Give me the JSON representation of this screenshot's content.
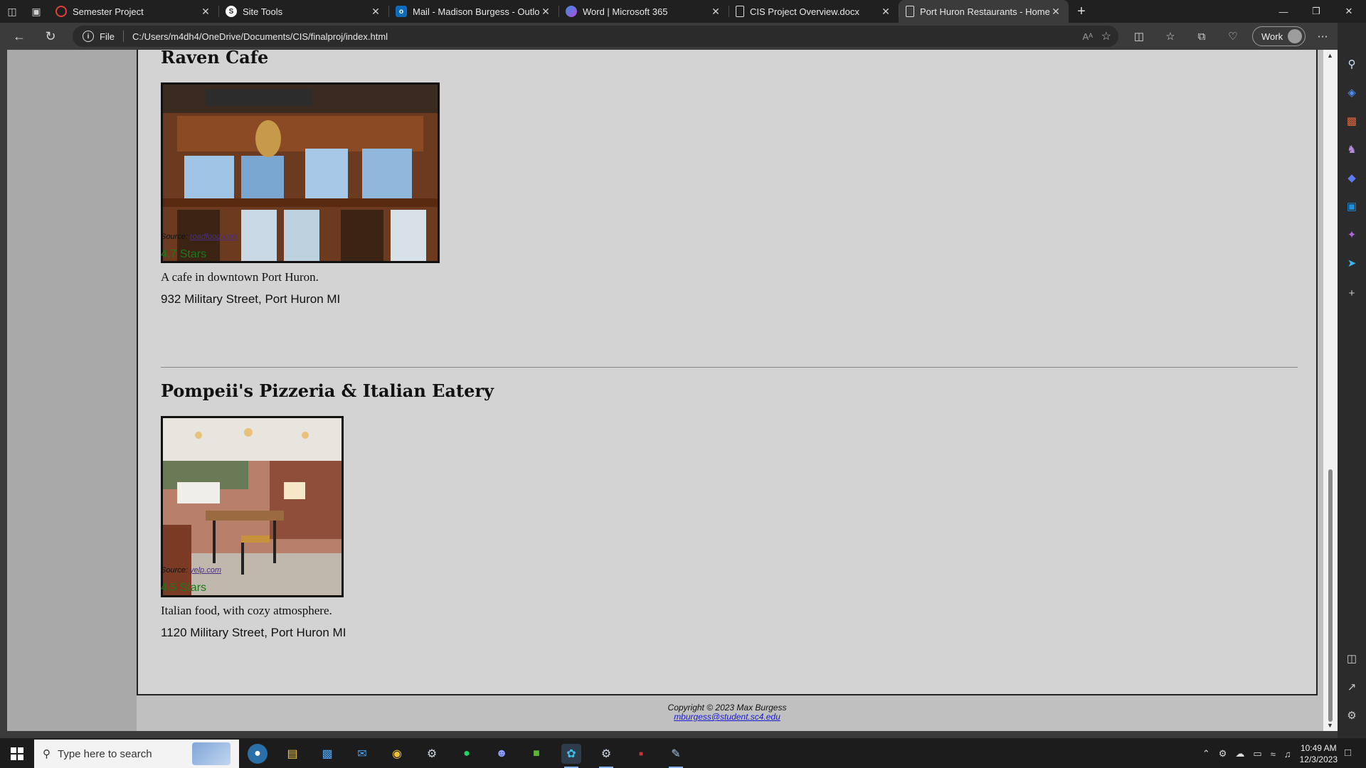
{
  "tabs": [
    {
      "title": "Semester Project",
      "icon": "circle-arrow-icon",
      "color": "#e0413a"
    },
    {
      "title": "Site Tools",
      "icon": "s-logo-icon",
      "color": "#ffffff"
    },
    {
      "title": "Mail - Madison Burgess - Outlook",
      "icon": "outlook-icon",
      "color": "#0f6cbd"
    },
    {
      "title": "Word | Microsoft 365",
      "icon": "m365-icon",
      "color": "#7b61d1"
    },
    {
      "title": "CIS Project Overview.docx",
      "icon": "document-icon",
      "color": "#e8e8e8"
    },
    {
      "title": "Port Huron Restaurants - Home Page",
      "icon": "document-icon",
      "color": "#e8e8e8"
    }
  ],
  "address": {
    "scheme": "File",
    "url": "C:/Users/m4dh4/OneDrive/Documents/CIS/finalproj/index.html",
    "read_aloud": "Aᴬ"
  },
  "profile": {
    "label": "Work"
  },
  "restaurants": [
    {
      "name": "Raven Cafe",
      "source_label": "Source:",
      "source_link": "roadfood.com",
      "rating": "4.7 Stars",
      "description": "A cafe in downtown Port Huron.",
      "address": "932 Military Street, Port Huron MI"
    },
    {
      "name": "Pompeii's Pizzeria & Italian Eatery",
      "source_label": "Source:",
      "source_link": "yelp.com",
      "rating": "4.5 Stars",
      "description": "Italian food, with cozy atmosphere.",
      "address": "1120 Military Street, Port Huron MI"
    }
  ],
  "footer": {
    "copyright": "Copyright © 2023 Max Burgess",
    "email": "mburgess@student.sc4.edu"
  },
  "taskbar": {
    "search_placeholder": "Type here to search",
    "time": "10:49 AM",
    "date": "12/3/2023"
  },
  "colors": {
    "page_bg": "#d3d3d3",
    "side_column": "#a9a9a9",
    "rating_green": "#1a7a1a",
    "link_purple": "#4b2e83"
  }
}
